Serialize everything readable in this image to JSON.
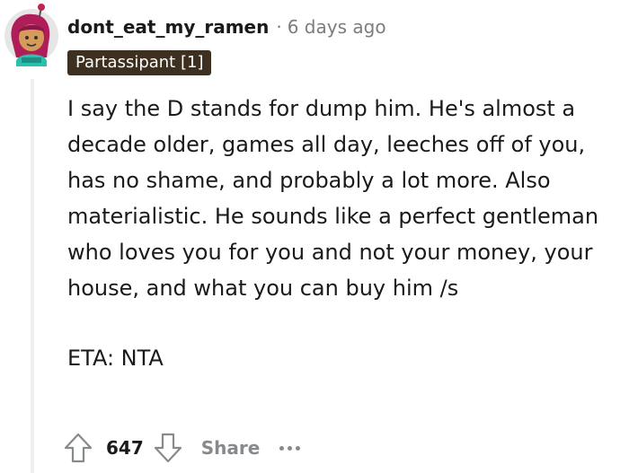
{
  "comment": {
    "username": "dont_eat_my_ramen",
    "separator": "·",
    "timestamp": "6 days ago",
    "flair": "Partassipant [1]",
    "paragraphs": [
      "I say the D stands for dump him. He's almost a decade older, games all day, leeches off of you, has no shame, and probably a lot more. Also materialistic. He sounds like a perfect gentleman who loves you for you and not your money, your house, and what you can buy him /s",
      "ETA: NTA"
    ],
    "score": "647",
    "share_label": "Share"
  },
  "icons": {
    "avatar": "avatar-icon",
    "upvote": "upvote-arrow-icon",
    "downvote": "downvote-arrow-icon",
    "more": "more-options-icon"
  },
  "colors": {
    "flair_bg": "#3d3020",
    "meta_gray": "#7c7c7c",
    "action_gray": "#878a8c",
    "thread_line": "#edeff1"
  }
}
